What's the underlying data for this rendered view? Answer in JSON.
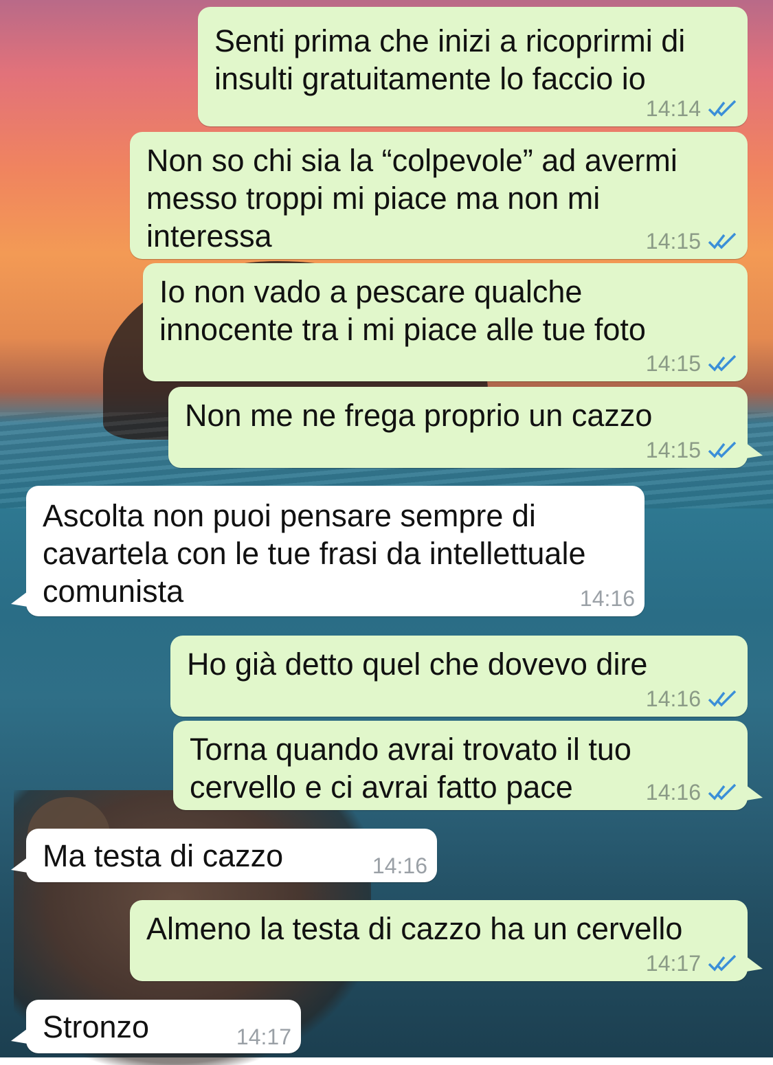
{
  "colors": {
    "outgoing_bubble": "#e1f7cb",
    "incoming_bubble": "#ffffff",
    "read_ticks": "#3b8fd8"
  },
  "messages": [
    {
      "direction": "outgoing",
      "text": "Senti prima che inizi a ricoprirmi di\ninsulti gratuitamente lo faccio io",
      "time": "14:14",
      "status": "read"
    },
    {
      "direction": "outgoing",
      "text": "Non so chi sia la “colpevole” ad avermi\nmesso troppi mi piace ma non mi\ninteressa",
      "time": "14:15",
      "status": "read"
    },
    {
      "direction": "outgoing",
      "text": "Io non vado a pescare qualche\ninnocente tra i mi piace alle tue foto",
      "time": "14:15",
      "status": "read"
    },
    {
      "direction": "outgoing",
      "text": "Non me ne frega proprio un cazzo",
      "time": "14:15",
      "status": "read"
    },
    {
      "direction": "incoming",
      "text": "Ascolta non puoi pensare sempre di\ncavartela con le tue frasi da intellettuale\ncomunista",
      "time": "14:16"
    },
    {
      "direction": "outgoing",
      "text": "Ho già detto quel che dovevo dire",
      "time": "14:16",
      "status": "read"
    },
    {
      "direction": "outgoing",
      "text": "Torna quando avrai trovato il tuo\ncervello e ci avrai fatto pace",
      "time": "14:16",
      "status": "read"
    },
    {
      "direction": "incoming",
      "text": "Ma testa di cazzo",
      "time": "14:16"
    },
    {
      "direction": "outgoing",
      "text": "Almeno la testa di cazzo ha un cervello",
      "time": "14:17",
      "status": "read"
    },
    {
      "direction": "incoming",
      "text": "Stronzo",
      "time": "14:17"
    }
  ]
}
